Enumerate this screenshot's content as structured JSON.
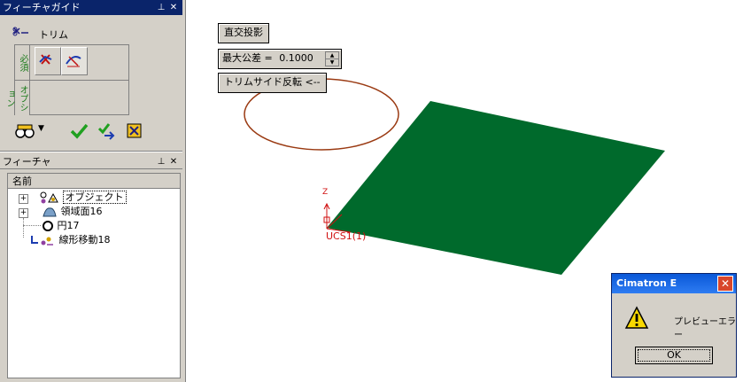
{
  "feature_guide": {
    "title": "フィーチャガイド",
    "pin_icon": "pin-icon",
    "close_icon": "close-icon",
    "operation_label": "トリム",
    "required_tab": "必須",
    "option_tab": "オプション"
  },
  "feature_tree": {
    "title": "フィーチャ",
    "column_header": "名前",
    "items": [
      {
        "label": "オブジェクト",
        "expandable": true,
        "icon": "objects-icon"
      },
      {
        "label": "領域面16",
        "expandable": true,
        "icon": "surface-icon"
      },
      {
        "label": "円17",
        "expandable": false,
        "icon": "circle-icon"
      },
      {
        "label": "線形移動18",
        "expandable": false,
        "icon": "linear-move-icon"
      }
    ]
  },
  "viewport": {
    "ortho_button": "直交投影",
    "max_tolerance_label": "最大公差 =",
    "max_tolerance_value": "0.1000",
    "trim_side_button": "トリムサイド反転 <--",
    "axis_z": "Z",
    "ucs_label": "UCS1(1)",
    "colors": {
      "plane": "#006a2c",
      "circle": "#9a3a12",
      "axis": "#d01010"
    }
  },
  "dialog": {
    "title": "Cimatron E",
    "message": "プレビューエラー",
    "ok_button": "OK",
    "icon": "warning-icon"
  }
}
